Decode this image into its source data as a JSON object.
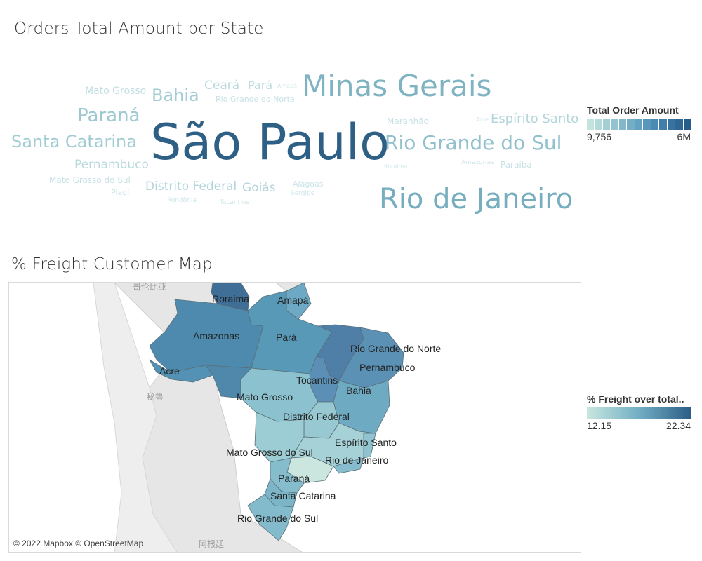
{
  "word_cloud": {
    "title": "Orders Total Amount per State",
    "words": [
      {
        "text": "São Paulo",
        "color": "#2e5f85"
      },
      {
        "text": "Minas Gerais",
        "color": "#7fb3c2"
      },
      {
        "text": "Rio de Janeiro",
        "color": "#76aebf"
      },
      {
        "text": "Rio Grande do Sul",
        "color": "#91c1cc"
      },
      {
        "text": "Paraná",
        "color": "#9dc8d1"
      },
      {
        "text": "Santa Catarina",
        "color": "#a4ccd5"
      },
      {
        "text": "Bahia",
        "color": "#a4ccd5"
      },
      {
        "text": "Distrito Federal",
        "color": "#b2d5db"
      },
      {
        "text": "Goiás",
        "color": "#b2d5db"
      },
      {
        "text": "Espírito Santo",
        "color": "#b2d5db"
      },
      {
        "text": "Pernambuco",
        "color": "#b9d9df"
      },
      {
        "text": "Ceará",
        "color": "#bcdbe0"
      },
      {
        "text": "Pará",
        "color": "#bcdbe0"
      },
      {
        "text": "Mato Grosso",
        "color": "#c2dee3"
      },
      {
        "text": "Maranhão",
        "color": "#c7e1e5"
      },
      {
        "text": "Mato Grosso do Sul",
        "color": "#c7e1e5"
      },
      {
        "text": "Paraíba",
        "color": "#c7e1e5"
      },
      {
        "text": "Rio Grande do Norte",
        "color": "#c9e2e6"
      },
      {
        "text": "Alagoas",
        "color": "#cbe3e6"
      },
      {
        "text": "Piauí",
        "color": "#cbe3e6"
      },
      {
        "text": "Sergipe",
        "color": "#d0e6e9"
      },
      {
        "text": "Tocantins",
        "color": "#d0e6e9"
      },
      {
        "text": "Rondônia",
        "color": "#d0e6e9"
      },
      {
        "text": "Amazonas",
        "color": "#d0e6e9"
      },
      {
        "text": "Roraima",
        "color": "#d3e8ea"
      },
      {
        "text": "Amapá",
        "color": "#d3e8ea"
      },
      {
        "text": "Acre",
        "color": "#d3e8ea"
      }
    ],
    "legend": {
      "title": "Total Order Amount",
      "min_label": "9,756",
      "max_label": "6M",
      "steps": [
        "#c3e4dd",
        "#b3d9d8",
        "#a3ced4",
        "#93c3d0",
        "#83b8cb",
        "#73adc6",
        "#64a2c1",
        "#5797bb",
        "#4b8bb3",
        "#417faa",
        "#3873a0",
        "#306895",
        "#285d8a"
      ]
    }
  },
  "map": {
    "title": "% Freight Customer Map",
    "attribution": "© 2022 Mapbox © OpenStreetMap",
    "background_labels": [
      "哥伦比亚",
      "秘鲁",
      "阿根廷"
    ],
    "state_labels": [
      "Roraima",
      "Amapá",
      "Amazonas",
      "Pará",
      "Rio Grande do Norte",
      "Pernambuco",
      "Acre",
      "Tocantins",
      "Bahia",
      "Mato Grosso",
      "Distrito Federal",
      "Espírito Santo",
      "Mato Grosso do Sul",
      "Rio de Janeiro",
      "Paraná",
      "Santa Catarina",
      "Rio Grande do Sul"
    ],
    "legend": {
      "title": "% Freight over total..",
      "min_label": "12.15",
      "max_label": "22.34",
      "gradient_start": "#c9e7df",
      "gradient_mid": "#72aec4",
      "gradient_end": "#2c5d86"
    },
    "colors": {
      "roraima": "#3f6e96",
      "amapa": "#6da9c4",
      "amazonas": "#4d8aad",
      "para": "#5799b6",
      "maranhao_piaui": "#4f7fa6",
      "northeast": "#5a91b4",
      "acre": "#5392b5",
      "rondonia": "#4f88ab",
      "tocantins": "#5b8fb5",
      "mato_grosso": "#8cc2cf",
      "goias": "#98c9d2",
      "bahia": "#6eabc2",
      "ms": "#9ccdd4",
      "mg": "#a6d1d6",
      "sp": "#cbe6df",
      "rj": "#86bccd",
      "es": "#8ec3cf",
      "pr": "#86bdcc",
      "sc": "#7cb5c8",
      "rs": "#83bbcc"
    }
  }
}
